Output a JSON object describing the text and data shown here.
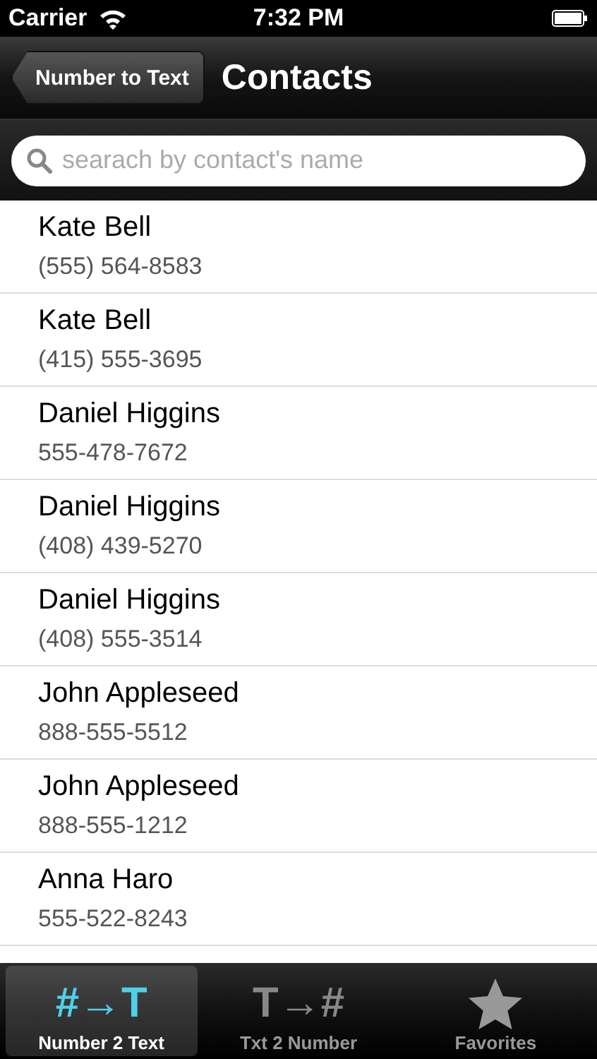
{
  "status_bar": {
    "carrier": "Carrier",
    "time": "7:32 PM"
  },
  "nav_bar": {
    "back": "Number to Text",
    "title": "Contacts"
  },
  "search": {
    "placeholder": "searach by contact's name"
  },
  "contacts": [
    {
      "name": "Kate Bell",
      "phone": "(555) 564-8583"
    },
    {
      "name": "Kate Bell",
      "phone": "(415) 555-3695"
    },
    {
      "name": "Daniel Higgins",
      "phone": "555-478-7672"
    },
    {
      "name": "Daniel Higgins",
      "phone": "(408) 439-5270"
    },
    {
      "name": "Daniel Higgins",
      "phone": "(408) 555-3514"
    },
    {
      "name": "John Appleseed",
      "phone": "888-555-5512"
    },
    {
      "name": "John Appleseed",
      "phone": "888-555-1212"
    },
    {
      "name": "Anna Haro",
      "phone": "555-522-8243"
    }
  ],
  "tabs": [
    {
      "kind": "glyph",
      "glyph": "#→T",
      "label": "Number 2 Text",
      "selected": true
    },
    {
      "kind": "glyph",
      "glyph": "T→#",
      "label": "Txt 2 Number",
      "selected": false
    },
    {
      "kind": "star",
      "label": "Favorites",
      "selected": false
    }
  ]
}
